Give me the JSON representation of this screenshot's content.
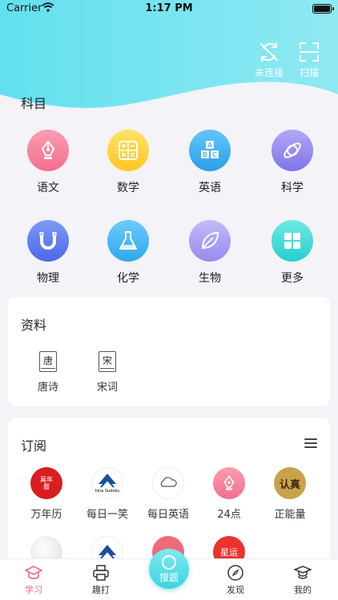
{
  "status": {
    "carrier": "Carrier",
    "time": "1:17 PM"
  },
  "header_actions": {
    "disconnect_label": "未连接",
    "scan_label": "扫描"
  },
  "subjects": {
    "title": "科目",
    "items": [
      {
        "label": "语文",
        "icon": "pen-nib-icon",
        "color": "#f47b95"
      },
      {
        "label": "数学",
        "icon": "calculator-icon",
        "color": "#ffd23c"
      },
      {
        "label": "英语",
        "icon": "abc-blocks-icon",
        "color": "#3ab0f0"
      },
      {
        "label": "科学",
        "icon": "planet-icon",
        "color": "#8c82f0"
      },
      {
        "label": "物理",
        "icon": "magnet-icon",
        "color": "#5b7cf2"
      },
      {
        "label": "化学",
        "icon": "flask-icon",
        "color": "#3fb7f2"
      },
      {
        "label": "生物",
        "icon": "leaf-icon",
        "color": "#a49af2"
      },
      {
        "label": "更多",
        "icon": "grid-more-icon",
        "color": "#3ed9d6"
      }
    ]
  },
  "materials": {
    "title": "资料",
    "items": [
      {
        "label": "唐诗",
        "glyph": "唐"
      },
      {
        "label": "宋词",
        "glyph": "宋"
      }
    ]
  },
  "subscriptions": {
    "title": "订阅",
    "items": [
      {
        "label": "万年历",
        "logo_text": "萬年曆"
      },
      {
        "label": "每日一笑",
        "logo_text": "hina Sudoku"
      },
      {
        "label": "每日英语",
        "logo_text": ""
      },
      {
        "label": "24点",
        "logo_text": ""
      },
      {
        "label": "正能量",
        "logo_text": "认真"
      }
    ],
    "row2": [
      {
        "logo_text": ""
      },
      {
        "logo_text": ""
      },
      {
        "logo_text": ""
      },
      {
        "logo_text": "星运"
      }
    ]
  },
  "tabbar": {
    "tabs": [
      {
        "label": "学习"
      },
      {
        "label": "趣打"
      },
      {
        "label": "发现"
      },
      {
        "label": "我的"
      }
    ],
    "fab_label": "搜题"
  },
  "colors": {
    "header": "#6fe3f0",
    "accent": "#f06a8a"
  }
}
